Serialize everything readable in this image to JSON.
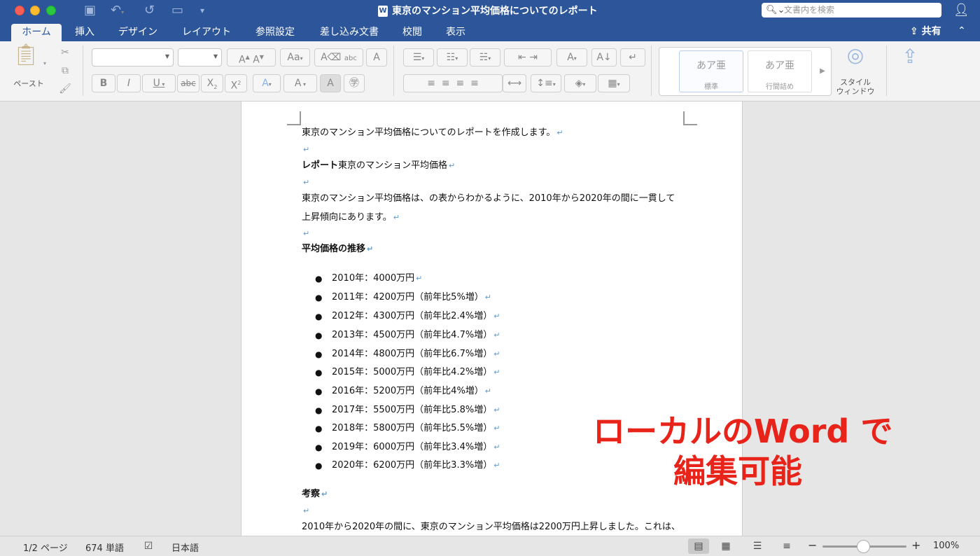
{
  "window": {
    "title": "東京のマンション平均価格についてのレポート",
    "search_placeholder": "文書内を検索"
  },
  "tabs": [
    {
      "label": "ホーム"
    },
    {
      "label": "挿入"
    },
    {
      "label": "デザイン"
    },
    {
      "label": "レイアウト"
    },
    {
      "label": "参照設定"
    },
    {
      "label": "差し込み文書"
    },
    {
      "label": "校閲"
    },
    {
      "label": "表示"
    }
  ],
  "share_label": "共有",
  "ribbon": {
    "paste_label": "ペースト",
    "styles": [
      {
        "preview": "あア亜",
        "name": "標準"
      },
      {
        "preview": "あア亜",
        "name": "行間詰め"
      }
    ],
    "style_window_label_1": "スタイル",
    "style_window_label_2": "ウィンドウ",
    "bold": "B",
    "italic": "I",
    "underline": "U",
    "strike": "abc"
  },
  "document": {
    "intro": "東京のマンション平均価格についてのレポートを作成します。",
    "heading_bold": "レポート",
    "heading_rest": "東京のマンション平均価格",
    "para1_line1": "東京のマンション平均価格は、の表からわかるように、2010年から2020年の間に一貫して",
    "para1_line2": "上昇傾向にあります。",
    "section_title": "平均価格の推移",
    "items": [
      "2010年：4000万円",
      "2011年：4200万円（前年比5%増）",
      "2012年：4300万円（前年比2.4%増）",
      "2013年：4500万円（前年比4.7%増）",
      "2014年：4800万円（前年比6.7%増）",
      "2015年：5000万円（前年比4.2%増）",
      "2016年：5200万円（前年比4%増）",
      "2017年：5500万円（前年比5.8%増）",
      "2018年：5800万円（前年比5.5%増）",
      "2019年：6000万円（前年比3.4%増）",
      "2020年：6200万円（前年比3.3%増）"
    ],
    "considerations_title": "考察",
    "final_line": "2010年から2020年の間に、東京のマンション平均価格は2200万円上昇しました。これは、"
  },
  "overlay": {
    "line1": "ローカルのWord で",
    "line2": "編集可能",
    "color": "#e8231a"
  },
  "status": {
    "page": "1/2 ページ",
    "words": "674 単語",
    "language": "日本語",
    "zoom": "100%",
    "zoom_minus": "−",
    "zoom_plus": "+"
  },
  "colors": {
    "titlebar": "#2c5699",
    "paragraph_mark": "#5b9bd5"
  }
}
